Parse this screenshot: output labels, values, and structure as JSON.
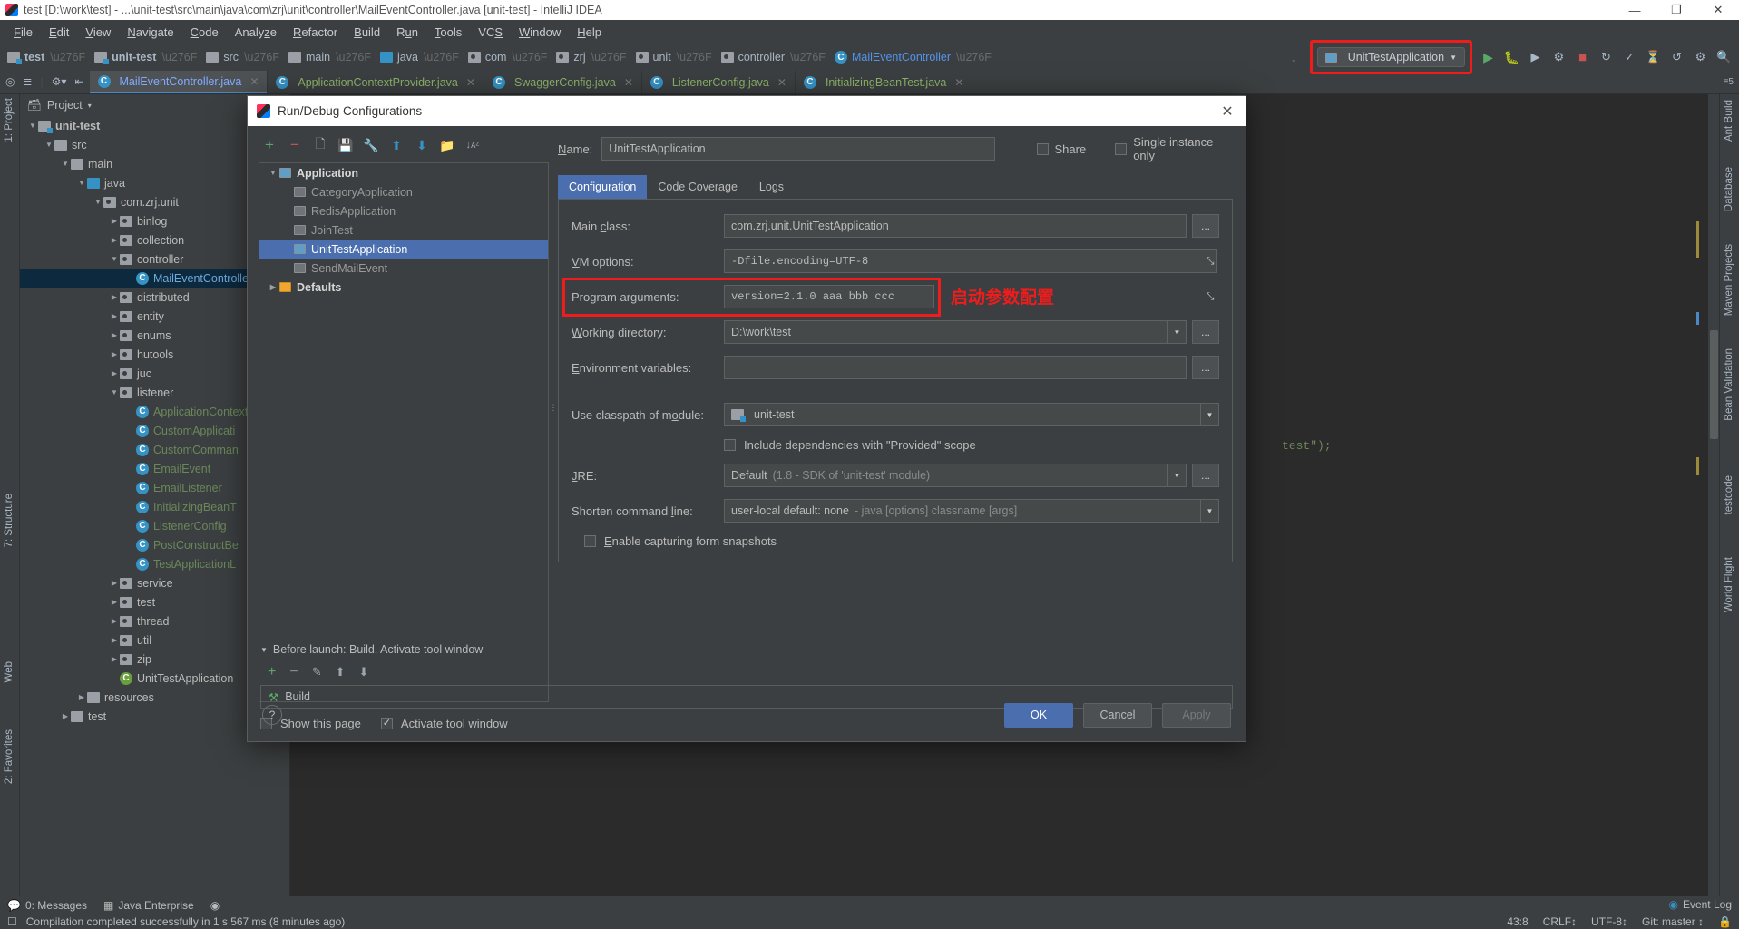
{
  "window": {
    "title": "test [D:\\work\\test] - ...\\unit-test\\src\\main\\java\\com\\zrj\\unit\\controller\\MailEventController.java [unit-test] - IntelliJ IDEA",
    "minimize": "—",
    "maximize": "❐",
    "close": "✕"
  },
  "menubar": [
    {
      "label": "File"
    },
    {
      "label": "Edit"
    },
    {
      "label": "View"
    },
    {
      "label": "Navigate"
    },
    {
      "label": "Code"
    },
    {
      "label": "Analyze"
    },
    {
      "label": "Refactor"
    },
    {
      "label": "Build"
    },
    {
      "label": "Run"
    },
    {
      "label": "Tools"
    },
    {
      "label": "VCS"
    },
    {
      "label": "Window"
    },
    {
      "label": "Help"
    }
  ],
  "breadcrumbs": [
    {
      "label": "test",
      "icon": "folder-module-icon",
      "bold": true
    },
    {
      "label": "unit-test",
      "icon": "folder-module-icon",
      "bold": true
    },
    {
      "label": "src",
      "icon": "folder-icon"
    },
    {
      "label": "main",
      "icon": "folder-icon"
    },
    {
      "label": "java",
      "icon": "folder-source-icon"
    },
    {
      "label": "com",
      "icon": "package-icon"
    },
    {
      "label": "zrj",
      "icon": "package-icon"
    },
    {
      "label": "unit",
      "icon": "package-icon"
    },
    {
      "label": "controller",
      "icon": "package-icon"
    },
    {
      "label": "MailEventController",
      "icon": "class-icon"
    }
  ],
  "toolbar": {
    "run_config_name": "UnitTestApplication",
    "dropdown_arrow": "▼",
    "run_icon": "▶",
    "debug_icon": "🐞",
    "download_icon": "↓"
  },
  "editor_tabs": [
    {
      "label": "MailEventController.java",
      "active": true
    },
    {
      "label": "ApplicationContextProvider.java",
      "active": false
    },
    {
      "label": "SwaggerConfig.java",
      "active": false
    },
    {
      "label": "ListenerConfig.java",
      "active": false
    },
    {
      "label": "InitializingBeanTest.java",
      "active": false
    }
  ],
  "project_panel": {
    "title": "Project",
    "tool_label_left_top": "1: Project",
    "tool_label_structure": "7: Structure",
    "tool_label_web": "Web",
    "tool_label_favorites": "2: Favorites",
    "tree": [
      {
        "label": "unit-test",
        "indent": 0,
        "arrow": "▼",
        "icon": "folder-module-icon",
        "bold": true
      },
      {
        "label": "src",
        "indent": 1,
        "arrow": "▼",
        "icon": "folder-icon"
      },
      {
        "label": "main",
        "indent": 2,
        "arrow": "▼",
        "icon": "folder-icon"
      },
      {
        "label": "java",
        "indent": 3,
        "arrow": "▼",
        "icon": "folder-source-icon"
      },
      {
        "label": "com.zrj.unit",
        "indent": 4,
        "arrow": "▼",
        "icon": "package-icon"
      },
      {
        "label": "binlog",
        "indent": 5,
        "arrow": "▶",
        "icon": "package-icon"
      },
      {
        "label": "collection",
        "indent": 5,
        "arrow": "▶",
        "icon": "package-icon"
      },
      {
        "label": "controller",
        "indent": 5,
        "arrow": "▼",
        "icon": "package-icon"
      },
      {
        "label": "MailEventController",
        "indent": 6,
        "arrow": "",
        "icon": "class-icon",
        "selected": true
      },
      {
        "label": "distributed",
        "indent": 5,
        "arrow": "▶",
        "icon": "package-icon"
      },
      {
        "label": "entity",
        "indent": 5,
        "arrow": "▶",
        "icon": "package-icon"
      },
      {
        "label": "enums",
        "indent": 5,
        "arrow": "▶",
        "icon": "package-icon"
      },
      {
        "label": "hutools",
        "indent": 5,
        "arrow": "▶",
        "icon": "package-icon"
      },
      {
        "label": "juc",
        "indent": 5,
        "arrow": "▶",
        "icon": "package-icon"
      },
      {
        "label": "listener",
        "indent": 5,
        "arrow": "▼",
        "icon": "package-icon"
      },
      {
        "label": "ApplicationContext",
        "indent": 6,
        "arrow": "",
        "icon": "class-icon",
        "java": true
      },
      {
        "label": "CustomApplicati",
        "indent": 6,
        "arrow": "",
        "icon": "class-icon",
        "java": true
      },
      {
        "label": "CustomComman",
        "indent": 6,
        "arrow": "",
        "icon": "class-icon",
        "java": true
      },
      {
        "label": "EmailEvent",
        "indent": 6,
        "arrow": "",
        "icon": "class-icon",
        "java": true
      },
      {
        "label": "EmailListener",
        "indent": 6,
        "arrow": "",
        "icon": "class-icon",
        "java": true
      },
      {
        "label": "InitializingBeanT",
        "indent": 6,
        "arrow": "",
        "icon": "class-icon",
        "java": true
      },
      {
        "label": "ListenerConfig",
        "indent": 6,
        "arrow": "",
        "icon": "class-icon",
        "java": true
      },
      {
        "label": "PostConstructBe",
        "indent": 6,
        "arrow": "",
        "icon": "class-icon",
        "java": true
      },
      {
        "label": "TestApplicationL",
        "indent": 6,
        "arrow": "",
        "icon": "class-icon",
        "java": true
      },
      {
        "label": "service",
        "indent": 5,
        "arrow": "▶",
        "icon": "package-icon"
      },
      {
        "label": "test",
        "indent": 5,
        "arrow": "▶",
        "icon": "package-icon"
      },
      {
        "label": "thread",
        "indent": 5,
        "arrow": "▶",
        "icon": "package-icon"
      },
      {
        "label": "util",
        "indent": 5,
        "arrow": "▶",
        "icon": "package-icon"
      },
      {
        "label": "zip",
        "indent": 5,
        "arrow": "▶",
        "icon": "package-icon"
      },
      {
        "label": "UnitTestApplication",
        "indent": 5,
        "arrow": "",
        "icon": "spring-class-icon"
      },
      {
        "label": "resources",
        "indent": 3,
        "arrow": "▶",
        "icon": "folder-resources-icon"
      },
      {
        "label": "test",
        "indent": 2,
        "arrow": "▶",
        "icon": "folder-icon"
      }
    ]
  },
  "editor": {
    "visible_code": "test\");"
  },
  "right_strip": [
    {
      "label": "Ant Build"
    },
    {
      "label": "Database"
    },
    {
      "label": "Maven Projects"
    },
    {
      "label": "Bean Validation"
    },
    {
      "label": "testcode"
    },
    {
      "label": "World Flight"
    }
  ],
  "dialog": {
    "title": "Run/Debug Configurations",
    "close_icon": "✕",
    "toolbar_icons": [
      {
        "name": "add-icon",
        "glyph": "+",
        "color": "#59a869"
      },
      {
        "name": "remove-icon",
        "glyph": "−",
        "color": "#c75450"
      },
      {
        "name": "copy-icon",
        "glyph": "❐",
        "color": "#9aa7b0"
      },
      {
        "name": "save-icon",
        "glyph": "💾",
        "color": "#9aa7b0"
      },
      {
        "name": "edit-templates-icon",
        "glyph": "🔧",
        "color": "#f0a732"
      },
      {
        "name": "move-up-icon",
        "glyph": "⬆",
        "color": "#3592c4"
      },
      {
        "name": "move-down-icon",
        "glyph": "⬇",
        "color": "#3592c4"
      },
      {
        "name": "new-folder-icon",
        "glyph": "📁",
        "color": "#9aa7b0"
      },
      {
        "name": "sort-alpha-icon",
        "glyph": "↓ᴀ",
        "color": "#9aa7b0"
      }
    ],
    "config_tree": [
      {
        "label": "Application",
        "indent": 0,
        "arrow": "▼",
        "bold": true,
        "icon": "application-icon"
      },
      {
        "label": "CategoryApplication",
        "indent": 1,
        "arrow": "",
        "dim": true,
        "icon": "application-icon"
      },
      {
        "label": "RedisApplication",
        "indent": 1,
        "arrow": "",
        "dim": true,
        "icon": "application-icon"
      },
      {
        "label": "JoinTest",
        "indent": 1,
        "arrow": "",
        "dim": true,
        "icon": "application-icon"
      },
      {
        "label": "UnitTestApplication",
        "indent": 1,
        "arrow": "",
        "selected": true,
        "icon": "application-icon"
      },
      {
        "label": "SendMailEvent",
        "indent": 1,
        "arrow": "",
        "dim": true,
        "icon": "application-icon"
      },
      {
        "label": "Defaults",
        "indent": 0,
        "arrow": "▶",
        "bold": true,
        "icon": "defaults-icon"
      }
    ],
    "name_label": "Name:",
    "name_value": "UnitTestApplication",
    "share_label": "Share",
    "single_instance_label": "Single instance only",
    "tabs": [
      {
        "label": "Configuration",
        "active": true
      },
      {
        "label": "Code Coverage",
        "active": false
      },
      {
        "label": "Logs",
        "active": false
      }
    ],
    "fields": {
      "main_class_label": "Main class:",
      "main_class_value": "com.zrj.unit.UnitTestApplication",
      "vm_options_label": "VM options:",
      "vm_options_value": "-Dfile.encoding=UTF-8",
      "program_arguments_label": "Program arguments:",
      "program_arguments_value": "version=2.1.0 aaa bbb ccc",
      "working_directory_label": "Working directory:",
      "working_directory_value": "D:\\work\\test",
      "environment_variables_label": "Environment variables:",
      "environment_variables_value": "",
      "use_classpath_label": "Use classpath of module:",
      "use_classpath_value": "unit-test",
      "include_provided_label": "Include dependencies with \"Provided\" scope",
      "jre_label": "JRE:",
      "jre_value": "Default",
      "jre_value_hint": "(1.8 - SDK of 'unit-test' module)",
      "shorten_cmd_label": "Shorten command line:",
      "shorten_cmd_value": "user-local default: none",
      "shorten_cmd_hint": "- java [options] classname [args]",
      "enable_snapshots_label": "Enable capturing form snapshots",
      "browse_button": "...",
      "expand_button": "⤡",
      "dropdown_arrow": "▼"
    },
    "before_launch": {
      "header": "Before launch: Build, Activate tool window",
      "collapse_arrow": "▼",
      "tool_icons": [
        {
          "name": "add-task-icon",
          "glyph": "+",
          "color": "#59a869"
        },
        {
          "name": "remove-task-icon",
          "glyph": "−",
          "color": "#8a8d8f"
        },
        {
          "name": "edit-task-icon",
          "glyph": "✎",
          "color": "#9aa7b0"
        },
        {
          "name": "move-task-up-icon",
          "glyph": "⬆",
          "color": "#9aa7b0"
        },
        {
          "name": "move-task-down-icon",
          "glyph": "⬇",
          "color": "#9aa7b0"
        }
      ],
      "task_label": "Build",
      "show_page_label": "Show this page",
      "activate_tool_window_label": "Activate tool window"
    },
    "buttons": {
      "help": "?",
      "ok": "OK",
      "cancel": "Cancel",
      "apply": "Apply"
    },
    "annotation": "启动参数配置",
    "accent_red": "#ef1c1c",
    "accent_blue": "#4b6eaf"
  },
  "statusbar": {
    "messages": "0: Messages",
    "java_enterprise": "Java Enterprise",
    "compile_status": "Compilation completed successfully in 1 s 567 ms (8 minutes ago)",
    "event_log": "Event Log",
    "caret": "43:8",
    "line_sep": "CRLF↕",
    "encoding": "UTF-8↕",
    "branch": "Git: master ↕",
    "lock_icon": "🔒"
  }
}
